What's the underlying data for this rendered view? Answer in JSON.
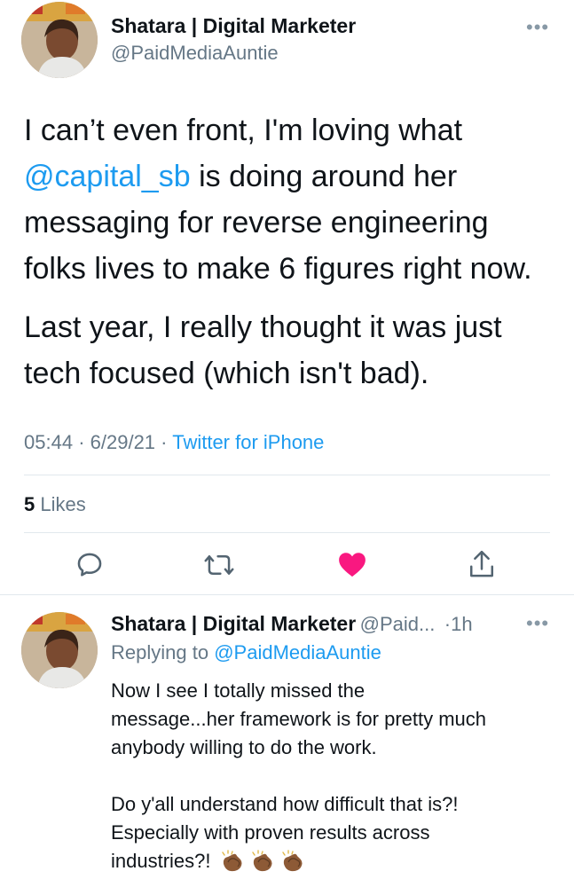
{
  "main_tweet": {
    "author_name": "Shatara | Digital Marketer",
    "author_handle": "@PaidMediaAuntie",
    "more_label": "•••",
    "text_line1": "I can’t even front, I'm loving what",
    "mention": "@capital_sb",
    "text_line2_rest": " is doing around her",
    "text_line3": "messaging for reverse engineering",
    "text_line4": "folks lives to make 6 figures right now.",
    "text_line5": "Last year, I really thought it was just",
    "text_line6": "tech focused (which isn't bad).",
    "time": "05:44",
    "date": "6/29/21",
    "separator": "·",
    "source": "Twitter for iPhone",
    "likes_count": "5",
    "likes_label": "Likes",
    "liked": true
  },
  "reply_tweet": {
    "author_name": "Shatara | Digital Marketer",
    "author_handle_truncated": "@Paid...",
    "separator": "·",
    "age": "1h",
    "more_label": "•••",
    "replying_to_label": "Replying to",
    "replying_to_handle": "@PaidMediaAuntie",
    "line1": "Now I see I totally missed the",
    "line2": "message...her framework is for pretty much",
    "line3": "anybody willing to do the work.",
    "line4": "Do y'all understand how difficult that is?!",
    "line5": "Especially with proven results across",
    "line6": "industries?!"
  },
  "icons": {
    "reply": "comment-bubble-icon",
    "retweet": "retweet-icon",
    "like": "heart-icon",
    "share": "share-icon",
    "clap": "clapping-hands-emoji"
  },
  "colors": {
    "accent": "#1d9bf0",
    "like": "#f91880",
    "secondary_text": "#657786",
    "divider": "#e1e8ed"
  }
}
